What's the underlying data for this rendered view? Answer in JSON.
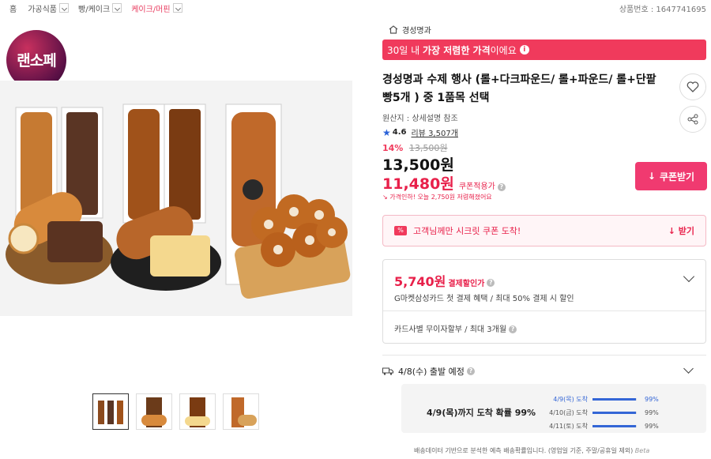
{
  "breadcrumb": [
    {
      "label": "홈",
      "has_dropdown": false
    },
    {
      "label": "가공식품",
      "has_dropdown": true
    },
    {
      "label": "빵/케이크",
      "has_dropdown": true
    },
    {
      "label": "케이크/머핀",
      "has_dropdown": true,
      "active": true
    }
  ],
  "product_number": "상품번호 : 1647741695",
  "logo_text": "랜소페",
  "thumbnails_count": 4,
  "store": {
    "name": "경성명과"
  },
  "banner": {
    "prefix": "30일 내 ",
    "bold": "가장 저렴한 가격",
    "suffix": "이에요",
    "info_icon": "i"
  },
  "title": "경성명과 수제 행사 (롤+다크파운드/ 롤+파운드/ 롤+단팥빵5개 ) 중 1품목 선택",
  "origin": "원산지 : 상세설명 참조",
  "rating": {
    "star": "★",
    "score": "4.6",
    "reviews": "리뷰 3,507개"
  },
  "discount": {
    "percent": "14%",
    "original": "13,500원"
  },
  "price": "13,500원",
  "coupon_price": {
    "value": "11,480원",
    "label": "쿠폰적용가"
  },
  "price_drop": "가격인하! 오늘 2,750원 저렴해졌어요",
  "coupon_button": "쿠폰받기",
  "secret_coupon": {
    "tag": "%",
    "text": "고객님께만 시크릿 쿠폰 도착!",
    "action": "받기"
  },
  "payment": {
    "amount": "5,740원",
    "amount_label": "결제할인가",
    "description": "G마켓삼성카드 첫 결제 혜택 / 최대 50% 결제 시 할인",
    "installment": "카드사별 무이자할부 / 최대 3개월"
  },
  "shipping": {
    "departure": "4/8(수) 출발 예정",
    "arrival_probability": "4/9(목)까지 도착 확률 99%",
    "rows": [
      {
        "date": "4/9(목) 도착",
        "percent": "99%",
        "value": 0.99
      },
      {
        "date": "4/10(금) 도착",
        "percent": "99%",
        "value": 0.99
      },
      {
        "date": "4/11(토) 도착",
        "percent": "99%",
        "value": 0.99
      }
    ],
    "note": "배송데이터 기반으로 분석한 예측 배송확률입니다. (영업일 기준, 주말/공휴일 제외)",
    "beta": "Beta"
  },
  "colors": {
    "accent": "#f03a5c",
    "coupon_red": "#e8204a",
    "blue": "#3466d6"
  }
}
